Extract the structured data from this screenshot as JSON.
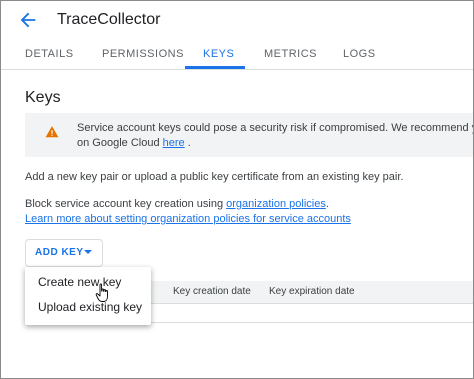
{
  "header": {
    "back_icon": "arrow-left-icon",
    "title": "TraceCollector"
  },
  "tabs": [
    {
      "label": "DETAILS",
      "active": false
    },
    {
      "label": "PERMISSIONS",
      "active": false
    },
    {
      "label": "KEYS",
      "active": true
    },
    {
      "label": "METRICS",
      "active": false
    },
    {
      "label": "LOGS",
      "active": false
    }
  ],
  "keys_section": {
    "title": "Keys",
    "alert": {
      "icon": "warning-icon",
      "line1": "Service account keys could pose a security risk if compromised. We recommend you avoi",
      "line2_prefix": "on Google Cloud ",
      "line2_link": "here",
      "line2_suffix": " ."
    },
    "intro": "Add a new key pair or upload a public key certificate from an existing key pair.",
    "block_prefix": "Block service account key creation using ",
    "block_link": "organization policies",
    "block_suffix": ".",
    "learn_more_link": "Learn more about setting organization policies for service accounts",
    "add_key_label": "ADD KEY",
    "add_key_icon": "caret-down-icon"
  },
  "table": {
    "columns": [
      "Key creation date",
      "Key expiration date"
    ]
  },
  "menu": {
    "items": [
      {
        "label": "Create new key"
      },
      {
        "label": "Upload existing key"
      }
    ]
  },
  "colors": {
    "accent": "#1a73e8",
    "warning": "#e37400",
    "alert_bg": "#f1f3f4"
  }
}
